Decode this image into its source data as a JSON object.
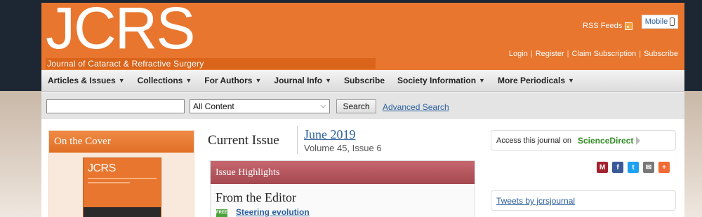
{
  "header": {
    "logo": "JCRS",
    "logo_subtitle": "Journal of Cataract & Refractive Surgery",
    "rss_label": "RSS Feeds",
    "mobile_label": "Mobile",
    "auth_links": [
      "Login",
      "Register",
      "Claim Subscription",
      "Subscribe"
    ]
  },
  "nav": {
    "items": [
      {
        "label": "Articles & Issues",
        "dropdown": true
      },
      {
        "label": "Collections",
        "dropdown": true
      },
      {
        "label": "For Authors",
        "dropdown": true
      },
      {
        "label": "Journal Info",
        "dropdown": true
      },
      {
        "label": "Subscribe",
        "dropdown": false
      },
      {
        "label": "Society Information",
        "dropdown": true
      },
      {
        "label": "More Periodicals",
        "dropdown": true
      }
    ]
  },
  "search": {
    "query_value": "",
    "scope_selected": "All Content",
    "button_label": "Search",
    "advanced_label": "Advanced Search"
  },
  "cover": {
    "heading": "On the Cover",
    "image_title": "JCRS"
  },
  "issue": {
    "heading": "Current Issue",
    "date": "June 2019",
    "volume": "Volume 45, Issue 6"
  },
  "highlights": {
    "heading": "Issue Highlights",
    "section": "From the Editor",
    "badge": "FREE",
    "article": "Steering evolution"
  },
  "sidebar": {
    "access_text": "Access this journal on",
    "access_link": "ScienceDirect",
    "tweets_link": "Tweets by jcrsjournal"
  },
  "colors": {
    "brand_orange": "#e8762e",
    "highlight_red": "#a44850",
    "link_blue": "#2b5f9e",
    "sciencedirect_green": "#2e8b1f"
  }
}
